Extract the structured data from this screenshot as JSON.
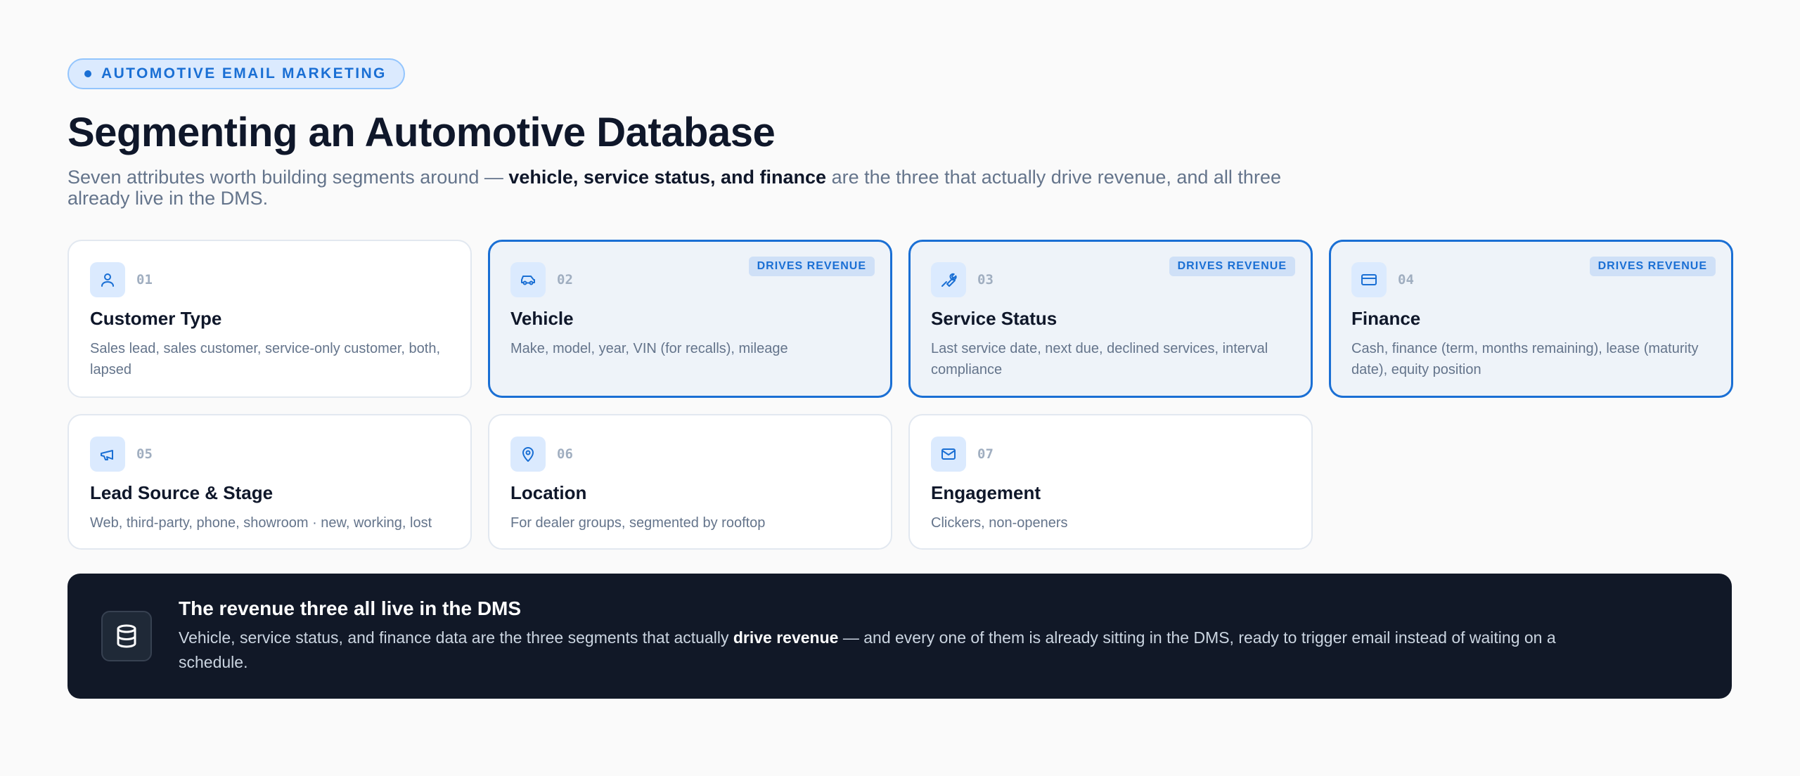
{
  "eyebrow": "AUTOMOTIVE EMAIL MARKETING",
  "title": "Segmenting an Automotive Database",
  "subtitle": {
    "before": "Seven attributes worth building segments around — ",
    "bold": "vehicle, service status, and finance",
    "after": " are the three that actually drive revenue, and all three already live in the DMS."
  },
  "badge_label": "DRIVES REVENUE",
  "cards": [
    {
      "num": "01",
      "title": "Customer Type",
      "desc": "Sales lead, sales customer, service-only customer, both, lapsed",
      "icon": "user-icon",
      "highlight": false
    },
    {
      "num": "02",
      "title": "Vehicle",
      "desc": "Make, model, year, VIN (for recalls), mileage",
      "icon": "car-icon",
      "highlight": true
    },
    {
      "num": "03",
      "title": "Service Status",
      "desc": "Last service date, next due, declined services, interval compliance",
      "icon": "wrench-icon",
      "highlight": true
    },
    {
      "num": "04",
      "title": "Finance",
      "desc": "Cash, finance (term, months remaining), lease (maturity date), equity position",
      "icon": "credit-card-icon",
      "highlight": true
    },
    {
      "num": "05",
      "title": "Lead Source & Stage",
      "desc": "Web, third-party, phone, showroom · new, working, lost",
      "icon": "megaphone-icon",
      "highlight": false
    },
    {
      "num": "06",
      "title": "Location",
      "desc": "For dealer groups, segmented by rooftop",
      "icon": "map-pin-icon",
      "highlight": false
    },
    {
      "num": "07",
      "title": "Engagement",
      "desc": "Clickers, non-openers",
      "icon": "mail-icon",
      "highlight": false
    }
  ],
  "banner": {
    "title": "The revenue three all live in the DMS",
    "body_before": "Vehicle, service status, and finance data are the three segments that actually ",
    "body_bold": "drive revenue",
    "body_after": " — and every one of them is already sitting in the DMS, ready to trigger email instead of waiting on a schedule.",
    "icon": "database-icon"
  },
  "colors": {
    "accent": "#1a6fd4",
    "dark": "#111827",
    "muted": "#64748b"
  }
}
